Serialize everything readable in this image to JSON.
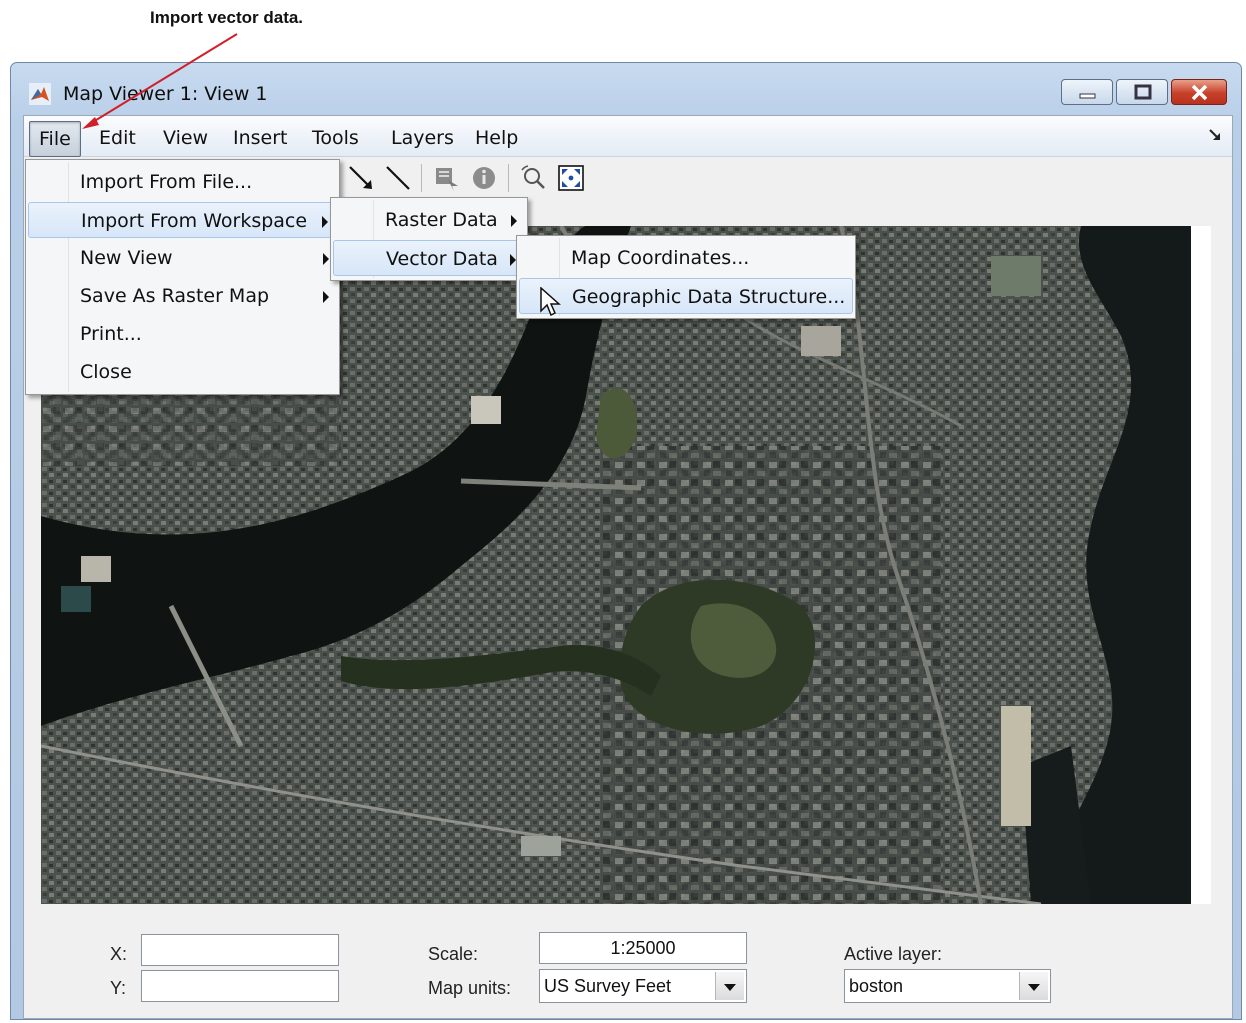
{
  "annotation": {
    "text": "Import vector data."
  },
  "window": {
    "title": "Map Viewer 1: View 1"
  },
  "menubar": {
    "items": [
      {
        "label": "File"
      },
      {
        "label": "Edit"
      },
      {
        "label": "View"
      },
      {
        "label": "Insert"
      },
      {
        "label": "Tools"
      },
      {
        "label": "Layers"
      },
      {
        "label": "Help"
      }
    ]
  },
  "file_menu": {
    "items": [
      {
        "label": "Import From File..."
      },
      {
        "label": "Import From Workspace"
      },
      {
        "label": "New View"
      },
      {
        "label": "Save As Raster Map"
      },
      {
        "label": "Print..."
      },
      {
        "label": "Close"
      }
    ]
  },
  "workspace_submenu": {
    "items": [
      {
        "label": "Raster Data"
      },
      {
        "label": "Vector Data"
      }
    ]
  },
  "vector_submenu": {
    "items": [
      {
        "label": "Map Coordinates..."
      },
      {
        "label": "Geographic Data Structure..."
      }
    ]
  },
  "toolbar": {
    "icons": [
      "select-arrow-icon",
      "line-icon",
      "datatip-icon",
      "info-icon",
      "zoom-icon",
      "fit-extent-icon"
    ]
  },
  "status": {
    "x_label": "X:",
    "x_value": "",
    "y_label": "Y:",
    "y_value": "",
    "scale_label": "Scale:",
    "scale_value": "1:25000",
    "map_units_label": "Map units:",
    "map_units_value": "US Survey Feet",
    "active_layer_label": "Active layer:",
    "active_layer_value": "boston"
  },
  "colors": {
    "annotation_arrow": "#d0202a",
    "title_bar": "#c7daf0",
    "close_button": "#c7402a",
    "menu_highlight": "#d7e6f8"
  }
}
